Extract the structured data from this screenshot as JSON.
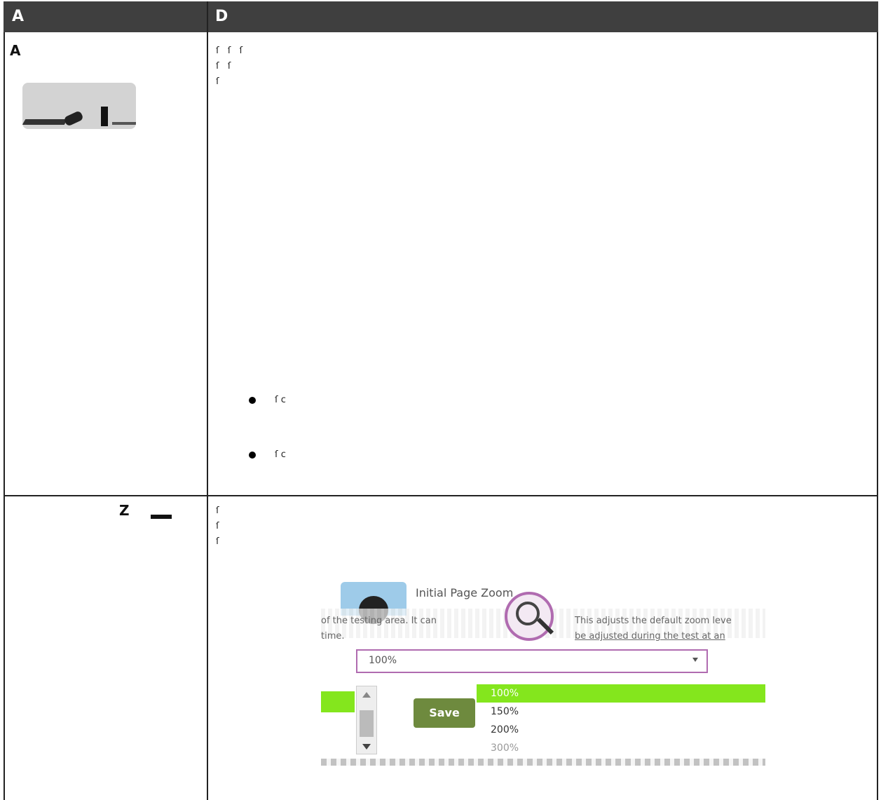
{
  "header": {
    "col1": "A",
    "col2": "D"
  },
  "rows": [
    {
      "name": "A",
      "paragraph": [
        "ſ",
        "ſ",
        "ſ",
        "ſ",
        "ſ",
        "ſ"
      ],
      "bullets": [
        {
          "text": "ſ c"
        },
        {
          "text": "ſ c"
        }
      ]
    },
    {
      "name": "Z",
      "paragraph": [
        "ſ",
        "ſ",
        "ſ"
      ]
    }
  ],
  "zoom_panel": {
    "title": "Initial Page Zoom",
    "text_left_1": "of the testing area. It can",
    "text_left_2": "time.",
    "text_right_1": "This adjusts the default zoom leve",
    "text_right_2": "be adjusted during the test at an",
    "select_value": "100%",
    "save_label": "Save",
    "options": [
      "100%",
      "150%",
      "200%",
      "300%"
    ],
    "selected_index": 0,
    "colors": {
      "selected": "#84e61d",
      "save": "#6e8a3e",
      "focus": "#b06bb0"
    }
  }
}
